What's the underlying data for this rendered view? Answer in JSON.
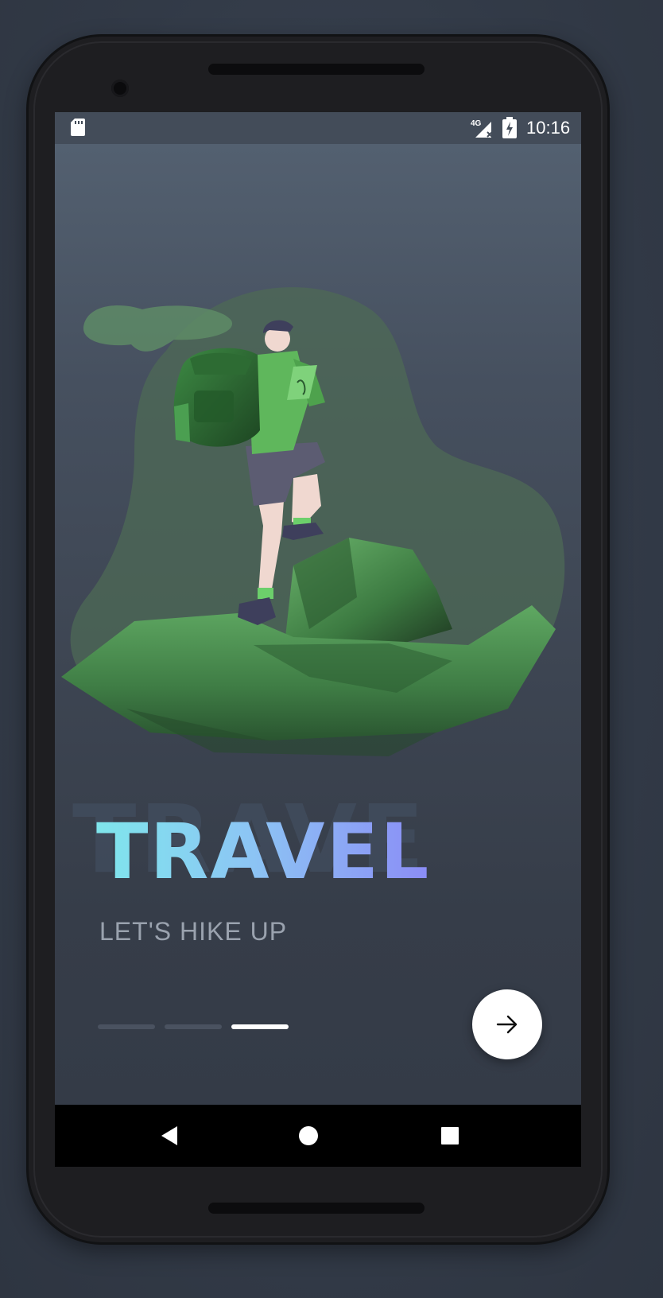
{
  "status_bar": {
    "network": "4G",
    "time": "10:16",
    "icons": [
      "sd-card-icon",
      "signal-icon",
      "battery-charging-icon"
    ]
  },
  "onboarding": {
    "ghost_word": "TRAVE",
    "title": "TRAVEL",
    "subtitle": "LET'S HIKE UP",
    "pages_total": 3,
    "active_page": 3,
    "next_icon": "arrow-right-icon"
  },
  "nav_bar": {
    "icons": [
      "back-icon",
      "home-icon",
      "recents-icon"
    ]
  },
  "colors": {
    "title_gradient_start": "#7fe6ec",
    "title_gradient_end": "#8b8cf6",
    "subtitle": "#9aa2ae",
    "illustration_green": "#5aa85c",
    "background": "#343c49"
  }
}
